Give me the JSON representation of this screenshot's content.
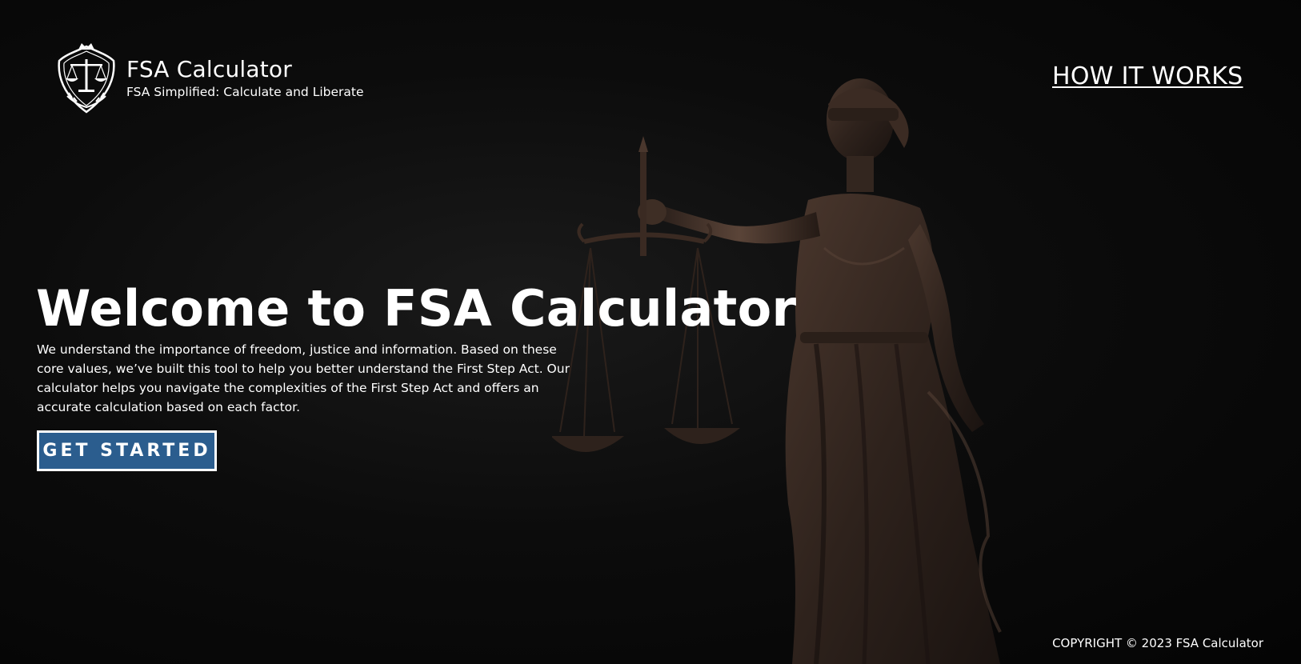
{
  "header": {
    "logo_icon": "scales-of-justice-emblem-icon",
    "brand_title": "FSA Calculator",
    "brand_tagline": "FSA Simplified: Calculate and Liberate",
    "nav_link_label": "HOW IT WORKS"
  },
  "hero": {
    "title": "Welcome to FSA Calculator",
    "description": "We understand the importance of freedom, justice and information. Based on these core values, we’ve built this tool to help you better understand the First Step Act. Our calculator helps you navigate the complexities of the First Step Act and offers an accurate calculation based on each factor.",
    "cta_label": "GET STARTED",
    "background_image": "lady-justice-statue-image"
  },
  "footer": {
    "copyright": "COPYRIGHT © 2023 FSA Calculator"
  },
  "colors": {
    "background": "#050505",
    "cta_background": "#2b5d8e",
    "text": "#ffffff",
    "statue_bronze": "#3a2a22"
  }
}
